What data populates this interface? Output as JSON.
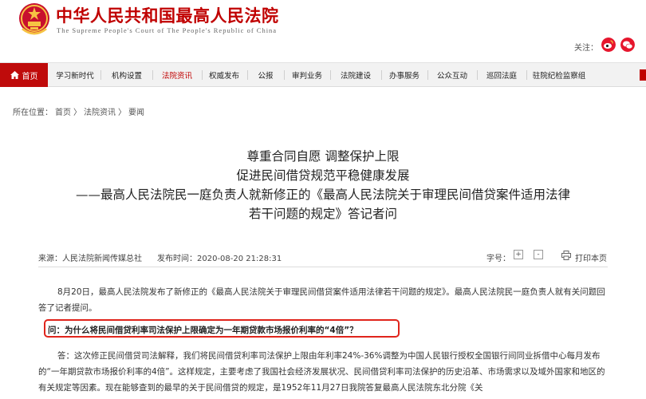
{
  "header": {
    "title": "中华人民共和国最高人民法院",
    "subtitle": "The Supreme People's Court of The People's Republic of China",
    "follow_label": "关注："
  },
  "nav": {
    "home_label": "首页",
    "items": [
      "学习新时代",
      "机构设置",
      "法院资讯",
      "权威发布",
      "公报",
      "审判业务",
      "法院建设",
      "办事服务",
      "公众互动",
      "巡回法庭",
      "驻院纪检监察组"
    ],
    "active_index": 2
  },
  "breadcrumb": {
    "prefix": "所在位置：",
    "items": [
      "首页",
      "法院资讯",
      "要闻"
    ],
    "separator": "〉"
  },
  "article": {
    "title_lines": [
      "尊重合同自愿  调整保护上限",
      "促进民间借贷规范平稳健康发展",
      "——最高人民法院民一庭负责人就新修正的《最高人民法院关于审理民间借贷案件适用法律",
      "若干问题的规定》答记者问"
    ],
    "source": "来源：人民法院新闻传媒总社",
    "publish_time": "发布时间：2020-08-20 21:28:31",
    "font_size_label": "字号：",
    "font_plus": "+",
    "font_minus": "-",
    "print_label": "打印本页",
    "paragraph1": "8月20日，最高人民法院发布了新修正的《最高人民法院关于审理民间借贷案件适用法律若干问题的规定》。最高人民法院民一庭负责人就有关问题回答了记者提问。",
    "question1": "问：为什么将民间借贷利率司法保护上限确定为一年期贷款市场报价利率的“4倍”？",
    "paragraph2": "答：这次修正民间借贷司法解释，我们将民间借贷利率司法保护上限由年利率24%-36%调整为中国人民银行授权全国银行间同业拆借中心每月发布的“一年期贷款市场报价利率的4倍”。这样规定，主要考虑了我国社会经济发展状况、民间借贷利率司法保护的历史沿革、市场需求以及域外国家和地区的有关规定等因素。现在能够查到的最早的关于民间借贷的规定，是1952年11月27日我院答复最高人民法院东北分院《关"
  },
  "colors": {
    "brand_red": "#c00000",
    "nav_bg": "#f2f2f2",
    "highlight_border": "#e0241b"
  },
  "icons": {
    "emblem": "national-emblem-icon",
    "weibo": "weibo-icon",
    "wechat": "wechat-icon",
    "home": "home-icon",
    "print": "print-icon"
  }
}
